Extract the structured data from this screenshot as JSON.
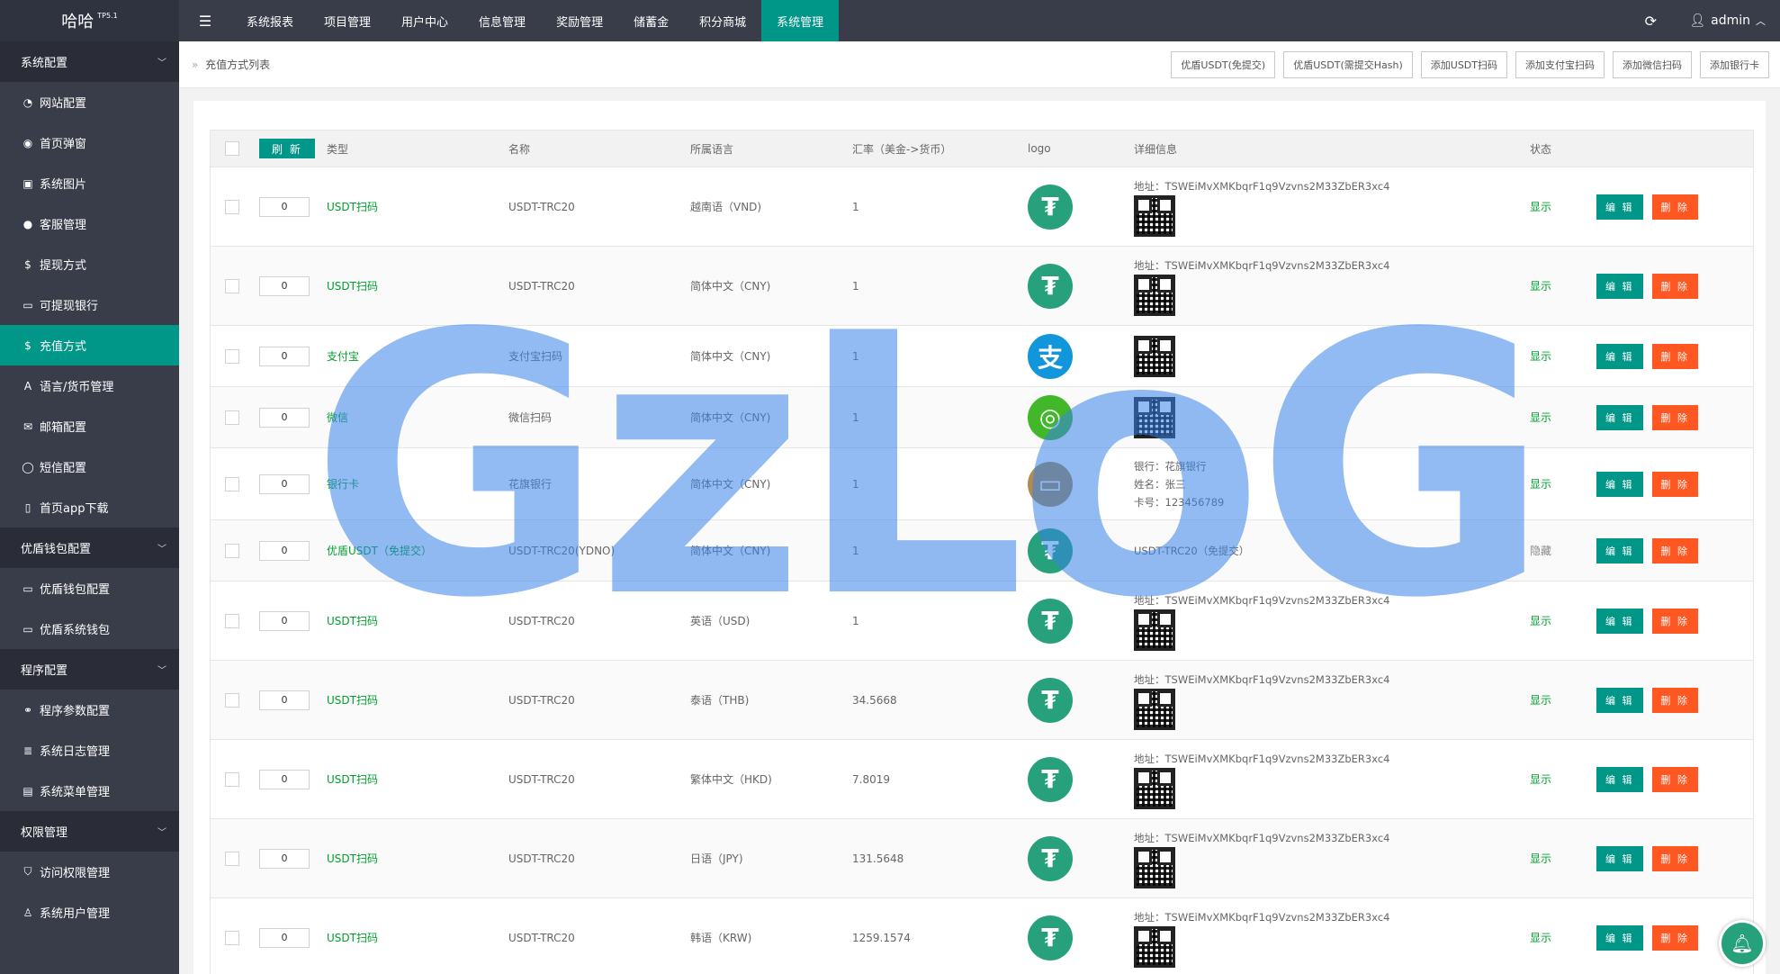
{
  "app": {
    "brand": "哈哈",
    "brand_sup": "TP5.1",
    "user": "admin"
  },
  "topnav": [
    {
      "label": "系统报表"
    },
    {
      "label": "项目管理"
    },
    {
      "label": "用户中心"
    },
    {
      "label": "信息管理"
    },
    {
      "label": "奖励管理"
    },
    {
      "label": "储蓄金"
    },
    {
      "label": "积分商城"
    },
    {
      "label": "系统管理"
    }
  ],
  "sidebar": [
    {
      "type": "group",
      "label": "系统配置"
    },
    {
      "type": "item",
      "label": "网站配置",
      "icon": "dashboard-icon"
    },
    {
      "type": "item",
      "label": "首页弹窗",
      "icon": "eye-icon"
    },
    {
      "type": "item",
      "label": "系统图片",
      "icon": "image-icon"
    },
    {
      "type": "item",
      "label": "客服管理",
      "icon": "chat-icon"
    },
    {
      "type": "item",
      "label": "提现方式",
      "icon": "dollar-icon"
    },
    {
      "type": "item",
      "label": "可提现银行",
      "icon": "card-icon"
    },
    {
      "type": "item",
      "label": "充值方式",
      "icon": "dollar-icon",
      "active": true
    },
    {
      "type": "item",
      "label": "语言/货币管理",
      "icon": "font-icon"
    },
    {
      "type": "item",
      "label": "邮箱配置",
      "icon": "mail-icon"
    },
    {
      "type": "item",
      "label": "短信配置",
      "icon": "message-icon"
    },
    {
      "type": "item",
      "label": "首页app下载",
      "icon": "mobile-icon"
    },
    {
      "type": "group",
      "label": "优盾钱包配置"
    },
    {
      "type": "item",
      "label": "优盾钱包配置",
      "icon": "card-icon"
    },
    {
      "type": "item",
      "label": "优盾系统钱包",
      "icon": "card-icon"
    },
    {
      "type": "group",
      "label": "程序配置"
    },
    {
      "type": "item",
      "label": "程序参数配置",
      "icon": "link-icon"
    },
    {
      "type": "item",
      "label": "系统日志管理",
      "icon": "log-icon"
    },
    {
      "type": "item",
      "label": "系统菜单管理",
      "icon": "menu-icon"
    },
    {
      "type": "group",
      "label": "权限管理"
    },
    {
      "type": "item",
      "label": "访问权限管理",
      "icon": "shield-icon"
    },
    {
      "type": "item",
      "label": "系统用户管理",
      "icon": "user-icon"
    }
  ],
  "breadcrumb": "充值方式列表",
  "toolbar": [
    {
      "label": "优盾USDT(免提交)"
    },
    {
      "label": "优盾USDT(需提交Hash)"
    },
    {
      "label": "添加USDT扫码"
    },
    {
      "label": "添加支付宝扫码"
    },
    {
      "label": "添加微信扫码"
    },
    {
      "label": "添加银行卡"
    }
  ],
  "table": {
    "refresh_label": "刷 新",
    "headers": {
      "type": "类型",
      "name": "名称",
      "lang": "所属语言",
      "rate": "汇率（美金->货币）",
      "logo": "logo",
      "detail": "详细信息",
      "status": "状态"
    },
    "edit_label": "编 辑",
    "delete_label": "删 除",
    "rows": [
      {
        "sort": "0",
        "type": "USDT扫码",
        "name": "USDT-TRC20",
        "lang": "越南语（VND)",
        "rate": "1",
        "logo": "tether",
        "detail": [
          "地址：TSWEiMvXMKbqrF1q9Vzvns2M33ZbER3xc4"
        ],
        "qr": true,
        "status": "显示"
      },
      {
        "sort": "0",
        "type": "USDT扫码",
        "name": "USDT-TRC20",
        "lang": "简体中文（CNY)",
        "rate": "1",
        "logo": "tether",
        "detail": [
          "地址：TSWEiMvXMKbqrF1q9Vzvns2M33ZbER3xc4"
        ],
        "qr": true,
        "status": "显示"
      },
      {
        "sort": "0",
        "type": "支付宝",
        "name": "支付宝扫码",
        "lang": "简体中文（CNY)",
        "rate": "1",
        "logo": "alipay",
        "detail": [],
        "qr": true,
        "status": "显示"
      },
      {
        "sort": "0",
        "type": "微信",
        "name": "微信扫码",
        "lang": "简体中文（CNY)",
        "rate": "1",
        "logo": "wechat",
        "detail": [],
        "qr": true,
        "status": "显示"
      },
      {
        "sort": "0",
        "type": "银行卡",
        "name": "花旗银行",
        "lang": "简体中文（CNY)",
        "rate": "1",
        "logo": "bankcard",
        "detail": [
          "银行：花旗银行",
          "姓名：张三",
          "卡号：123456789"
        ],
        "qr": false,
        "status": "显示"
      },
      {
        "sort": "0",
        "type": "优盾USDT（免提交）",
        "name": "USDT-TRC20(YDNO)",
        "lang": "简体中文（CNY)",
        "rate": "1",
        "logo": "tether",
        "detail": [
          "USDT-TRC20（免提交）"
        ],
        "qr": false,
        "status": "隐藏"
      },
      {
        "sort": "0",
        "type": "USDT扫码",
        "name": "USDT-TRC20",
        "lang": "英语（USD)",
        "rate": "1",
        "logo": "tether",
        "detail": [
          "地址：TSWEiMvXMKbqrF1q9Vzvns2M33ZbER3xc4"
        ],
        "qr": true,
        "status": "显示"
      },
      {
        "sort": "0",
        "type": "USDT扫码",
        "name": "USDT-TRC20",
        "lang": "泰语（THB)",
        "rate": "34.5668",
        "logo": "tether",
        "detail": [
          "地址：TSWEiMvXMKbqrF1q9Vzvns2M33ZbER3xc4"
        ],
        "qr": true,
        "status": "显示"
      },
      {
        "sort": "0",
        "type": "USDT扫码",
        "name": "USDT-TRC20",
        "lang": "繁体中文（HKD)",
        "rate": "7.8019",
        "logo": "tether",
        "detail": [
          "地址：TSWEiMvXMKbqrF1q9Vzvns2M33ZbER3xc4"
        ],
        "qr": true,
        "status": "显示"
      },
      {
        "sort": "0",
        "type": "USDT扫码",
        "name": "USDT-TRC20",
        "lang": "日语（JPY)",
        "rate": "131.5648",
        "logo": "tether",
        "detail": [
          "地址：TSWEiMvXMKbqrF1q9Vzvns2M33ZbER3xc4"
        ],
        "qr": true,
        "status": "显示"
      },
      {
        "sort": "0",
        "type": "USDT扫码",
        "name": "USDT-TRC20",
        "lang": "韩语（KRW)",
        "rate": "1259.1574",
        "logo": "tether",
        "detail": [
          "地址：TSWEiMvXMKbqrF1q9Vzvns2M33ZbER3xc4"
        ],
        "qr": true,
        "status": "显示"
      }
    ]
  },
  "watermark": "GzLoG",
  "colors": {
    "primary": "#009688",
    "danger": "#ff5722",
    "topbar": "#393d49",
    "tether": "#26a17b"
  }
}
